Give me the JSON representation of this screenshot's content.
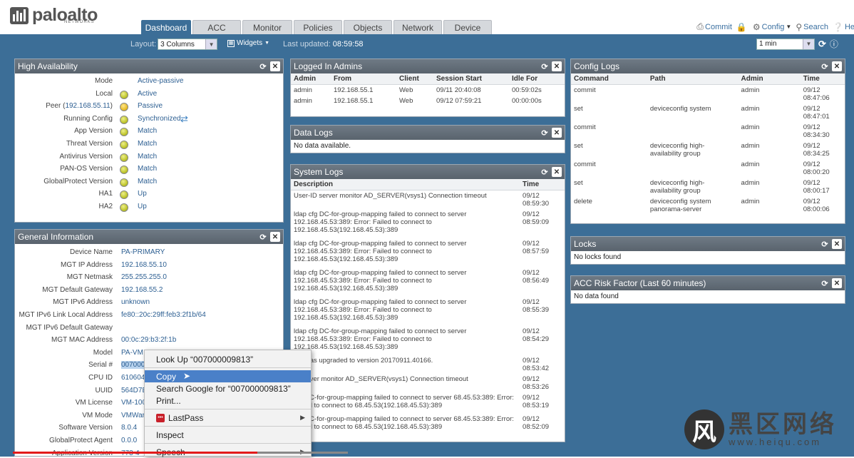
{
  "brand": {
    "name": "paloalto",
    "sub": "NETWORKS"
  },
  "tabs": [
    {
      "label": "Dashboard",
      "active": true
    },
    {
      "label": "ACC"
    },
    {
      "label": "Monitor"
    },
    {
      "label": "Policies"
    },
    {
      "label": "Objects"
    },
    {
      "label": "Network"
    },
    {
      "label": "Device"
    }
  ],
  "top_actions": {
    "commit": "Commit",
    "config": "Config",
    "search": "Search",
    "help": "Help"
  },
  "toolbar": {
    "layout_label": "Layout:",
    "layout_value": "3 Columns",
    "widgets": "Widgets",
    "updated_label": "Last updated:",
    "updated_value": "08:59:58",
    "refresh_value": "1 min"
  },
  "ha": {
    "title": "High Availability",
    "rows": [
      {
        "k": "Mode",
        "v": "Active-passive"
      },
      {
        "k": "Local",
        "v": "Active",
        "dot": "green"
      },
      {
        "k": "Peer (",
        "peer": "192.168.55.11",
        "k2": ")",
        "v": "Passive",
        "dot": "yellow"
      },
      {
        "k": "Running Config",
        "v": "Synchronized",
        "dot": "green"
      },
      {
        "k": "App Version",
        "v": "Match",
        "dot": "green"
      },
      {
        "k": "Threat Version",
        "v": "Match",
        "dot": "green"
      },
      {
        "k": "Antivirus Version",
        "v": "Match",
        "dot": "green"
      },
      {
        "k": "PAN-OS Version",
        "v": "Match",
        "dot": "green"
      },
      {
        "k": "GlobalProtect Version",
        "v": "Match",
        "dot": "green"
      },
      {
        "k": "HA1",
        "v": "Up",
        "dot": "green"
      },
      {
        "k": "HA2",
        "v": "Up",
        "dot": "green"
      }
    ]
  },
  "gi": {
    "title": "General Information",
    "rows": [
      {
        "k": "Device Name",
        "v": "PA-PRIMARY"
      },
      {
        "k": "MGT IP Address",
        "v": "192.168.55.10"
      },
      {
        "k": "MGT Netmask",
        "v": "255.255.255.0"
      },
      {
        "k": "MGT Default Gateway",
        "v": "192.168.55.2"
      },
      {
        "k": "MGT IPv6 Address",
        "v": "unknown"
      },
      {
        "k": "MGT IPv6 Link Local Address",
        "v": "fe80::20c:29ff:feb3:2f1b/64"
      },
      {
        "k": "MGT IPv6 Default Gateway",
        "v": ""
      },
      {
        "k": "MGT MAC Address",
        "v": "00:0c:29:b3:2f:1b"
      },
      {
        "k": "Model",
        "v": "PA-VM"
      },
      {
        "k": "Serial #",
        "v": "007000"
      },
      {
        "k": "CPU ID",
        "v": "610604"
      },
      {
        "k": "UUID",
        "v": "564D7E"
      },
      {
        "k": "VM License",
        "v": "VM-100"
      },
      {
        "k": "VM Mode",
        "v": "VMWare"
      },
      {
        "k": "Software Version",
        "v": "8.0.4"
      },
      {
        "k": "GlobalProtect Agent",
        "v": "0.0.0"
      },
      {
        "k": "Application Version",
        "v": "773-4"
      }
    ]
  },
  "admins": {
    "title": "Logged In Admins",
    "headers": [
      "Admin",
      "From",
      "Client",
      "Session Start",
      "Idle For"
    ],
    "rows": [
      [
        "admin",
        "192.168.55.1",
        "Web",
        "09/11 20:40:08",
        "00:59:02s"
      ],
      [
        "admin",
        "192.168.55.1",
        "Web",
        "09/12 07:59:21",
        "00:00:00s"
      ]
    ]
  },
  "datalogs": {
    "title": "Data Logs",
    "empty": "No data available."
  },
  "syslogs": {
    "title": "System Logs",
    "headers": [
      "Description",
      "Time"
    ],
    "rows": [
      {
        "d": "User-ID server monitor AD_SERVER(vsys1) Connection timeout",
        "t": "09/12 08:59:30"
      },
      {
        "d": "ldap cfg DC-for-group-mapping failed to connect to server 192.168.45.53:389: Error: Failed to connect to 192.168.45.53(192.168.45.53):389",
        "t": "09/12 08:59:09"
      },
      {
        "d": "ldap cfg DC-for-group-mapping failed to connect to server 192.168.45.53:389: Error: Failed to connect to 192.168.45.53(192.168.45.53):389",
        "t": "09/12 08:57:59"
      },
      {
        "d": "ldap cfg DC-for-group-mapping failed to connect to server 192.168.45.53:389: Error: Failed to connect to 192.168.45.53(192.168.45.53):389",
        "t": "09/12 08:56:49"
      },
      {
        "d": "ldap cfg DC-for-group-mapping failed to connect to server 192.168.45.53:389: Error: Failed to connect to 192.168.45.53(192.168.45.53):389",
        "t": "09/12 08:55:39"
      },
      {
        "d": "ldap cfg DC-for-group-mapping failed to connect to server 192.168.45.53:389: Error: Failed to connect to 192.168.45.53(192.168.45.53):389",
        "t": "09/12 08:54:29"
      },
      {
        "d": "DB was upgraded to version 20170911.40166.",
        "t": "09/12 08:53:42"
      },
      {
        "d": "D server monitor AD_SERVER(vsys1) Connection timeout",
        "t": "09/12 08:53:26"
      },
      {
        "d": "cfg DC-for-group-mapping failed to connect to server 68.45.53:389: Error: Failed to connect to 68.45.53(192.168.45.53):389",
        "t": "09/12 08:53:19"
      },
      {
        "d": "cfg DC-for-group-mapping failed to connect to server 68.45.53:389: Error: Failed to connect to 68.45.53(192.168.45.53):389",
        "t": "09/12 08:52:09"
      }
    ]
  },
  "configlogs": {
    "title": "Config Logs",
    "headers": [
      "Command",
      "Path",
      "Admin",
      "Time"
    ],
    "rows": [
      [
        "commit",
        "",
        "admin",
        "09/12 08:47:06"
      ],
      [
        "set",
        "deviceconfig system",
        "admin",
        "09/12 08:47:01"
      ],
      [
        "commit",
        "",
        "admin",
        "09/12 08:34:30"
      ],
      [
        "set",
        "deviceconfig high-availability group",
        "admin",
        "09/12 08:34:25"
      ],
      [
        "commit",
        "",
        "admin",
        "09/12 08:00:20"
      ],
      [
        "set",
        "deviceconfig high-availability group",
        "admin",
        "09/12 08:00:17"
      ],
      [
        "delete",
        "deviceconfig system panorama-server",
        "admin",
        "09/12 08:00:06"
      ]
    ]
  },
  "locks": {
    "title": "Locks",
    "empty": "No locks found"
  },
  "risk": {
    "title": "ACC Risk Factor (Last 60 minutes)",
    "empty": "No data found"
  },
  "context_menu": {
    "lookup": "Look Up “007000009813”",
    "copy": "Copy",
    "google": "Search Google for “007000009813”",
    "print": "Print...",
    "lastpass": "LastPass",
    "lastpass_badge": "•••",
    "inspect": "Inspect",
    "speech": "Speech"
  },
  "video_progress": 0.73,
  "watermark": {
    "logo": "风",
    "title": "黑区网络",
    "url": "www.heiqu.com"
  },
  "colors": {
    "header_blue": "#3c6e97",
    "panel_header": "#636d77",
    "value_blue": "#2d5f92",
    "menu_highlight": "#4a80c8"
  }
}
